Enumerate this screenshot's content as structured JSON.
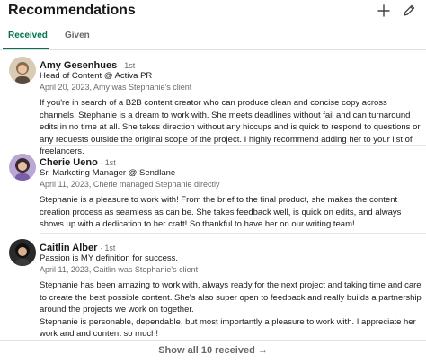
{
  "section": {
    "title": "Recommendations",
    "add_icon": "plus-icon",
    "edit_icon": "pencil-icon"
  },
  "tabs": [
    {
      "label": "Received",
      "active": true
    },
    {
      "label": "Given",
      "active": false
    }
  ],
  "recommendations": [
    {
      "name": "Amy Gesenhues",
      "dot": "·",
      "degree": "1st",
      "headline": "Head of Content @ Activa PR",
      "meta": "April 20, 2023, Amy was Stephanie's client",
      "paragraphs": [
        "If you're in search of a B2B content creator who can produce clean and concise copy across channels, Stephanie is a dream to work with. She meets deadlines without fail and can turnaround edits in no time at all. She takes direction without any hiccups and is quick to respond to questions or any requests outside the original scope of the project. I highly recommend adding her to your list of freelancers."
      ]
    },
    {
      "name": "Cherie Ueno",
      "dot": "·",
      "degree": "1st",
      "headline": "Sr. Marketing Manager @ Sendlane",
      "meta": "April 11, 2023, Cherie managed Stephanie directly",
      "paragraphs": [
        "Stephanie is a pleasure to work with! From the brief to the final product, she makes the content creation process as seamless as can be. She takes feedback well, is quick on edits, and always shows up with a dedication to her craft! So thankful to have her on our writing team!"
      ]
    },
    {
      "name": "Caitlin Alber",
      "dot": "·",
      "degree": "1st",
      "headline": "Passion is MY definition for success.",
      "meta": "April 11, 2023, Caitlin was Stephanie's client",
      "paragraphs": [
        "Stephanie has been amazing to work with, always ready for the next project and taking time and care to create the best possible content. She's also super open to feedback and really builds a partnership around the projects we work on together.",
        "Stephanie is personable, dependable, but most importantly a pleasure to work with. I appreciate her work and and content so much!"
      ]
    }
  ],
  "footer": {
    "show_all_label": "Show all 10 received",
    "arrow": "→"
  },
  "colors": {
    "accent": "#01754f",
    "muted_text": "#666666"
  }
}
